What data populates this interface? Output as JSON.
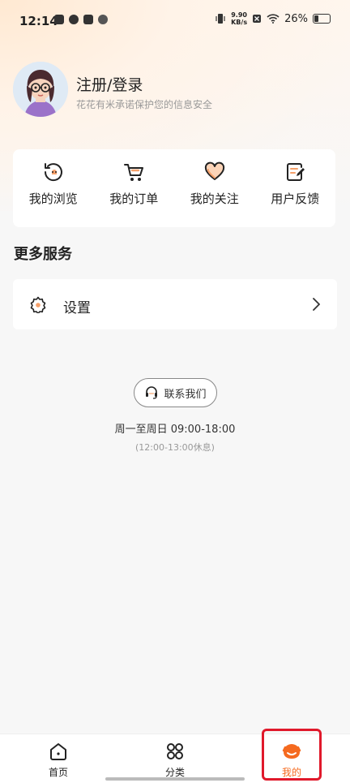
{
  "status_bar": {
    "time": "12:14",
    "net_speed_value": "9.90",
    "net_speed_unit": "KB/s",
    "battery": "26%"
  },
  "profile": {
    "title": "注册/登录",
    "subtitle": "花花有米承诺保护您的信息安全"
  },
  "quick_links": [
    {
      "label": "我的浏览",
      "icon": "browse-history-icon"
    },
    {
      "label": "我的订单",
      "icon": "cart-icon"
    },
    {
      "label": "我的关注",
      "icon": "heart-icon"
    },
    {
      "label": "用户反馈",
      "icon": "feedback-icon"
    }
  ],
  "more_services": {
    "title": "更多服务",
    "settings_label": "设置"
  },
  "contact": {
    "button_label": "联系我们",
    "hours": "周一至周日 09:00-18:00",
    "rest": "(12:00-13:00休息)"
  },
  "tabbar": {
    "items": [
      {
        "label": "首页",
        "icon": "home-icon"
      },
      {
        "label": "分类",
        "icon": "category-icon"
      },
      {
        "label": "我的",
        "icon": "profile-smile-icon"
      }
    ],
    "active_color": "#f56a1f"
  }
}
